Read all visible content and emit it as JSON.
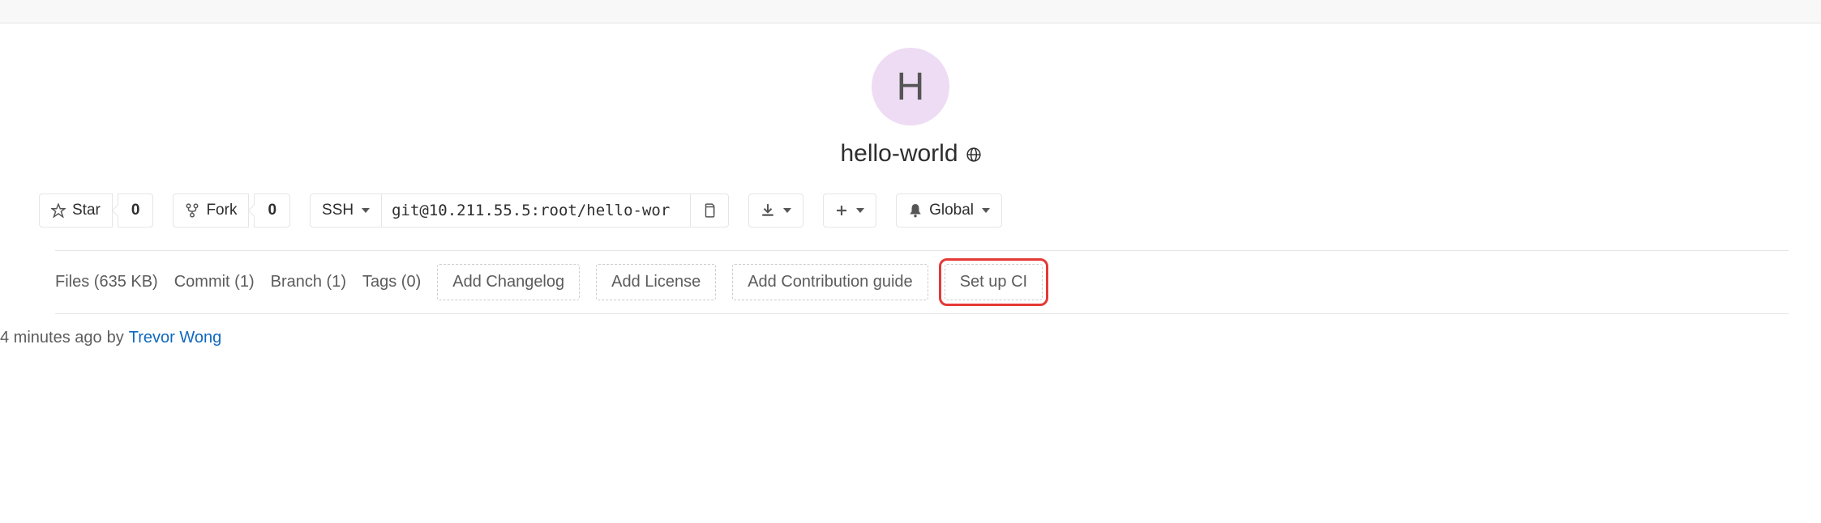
{
  "project": {
    "avatar_letter": "H",
    "name": "hello-world"
  },
  "actions": {
    "star_label": "Star",
    "star_count": "0",
    "fork_label": "Fork",
    "fork_count": "0",
    "protocol": "SSH",
    "clone_url": "git@10.211.55.5:root/hello-wor",
    "notification_label": "Global"
  },
  "stats": {
    "files": "Files (635 KB)",
    "commits": "Commit (1)",
    "branches": "Branch (1)",
    "tags": "Tags (0)",
    "add_changelog": "Add Changelog",
    "add_license": "Add License",
    "add_contributing": "Add Contribution guide",
    "setup_ci": "Set up CI"
  },
  "footer": {
    "time_ago": "4 minutes ago",
    "by": "by",
    "author": "Trevor Wong"
  }
}
